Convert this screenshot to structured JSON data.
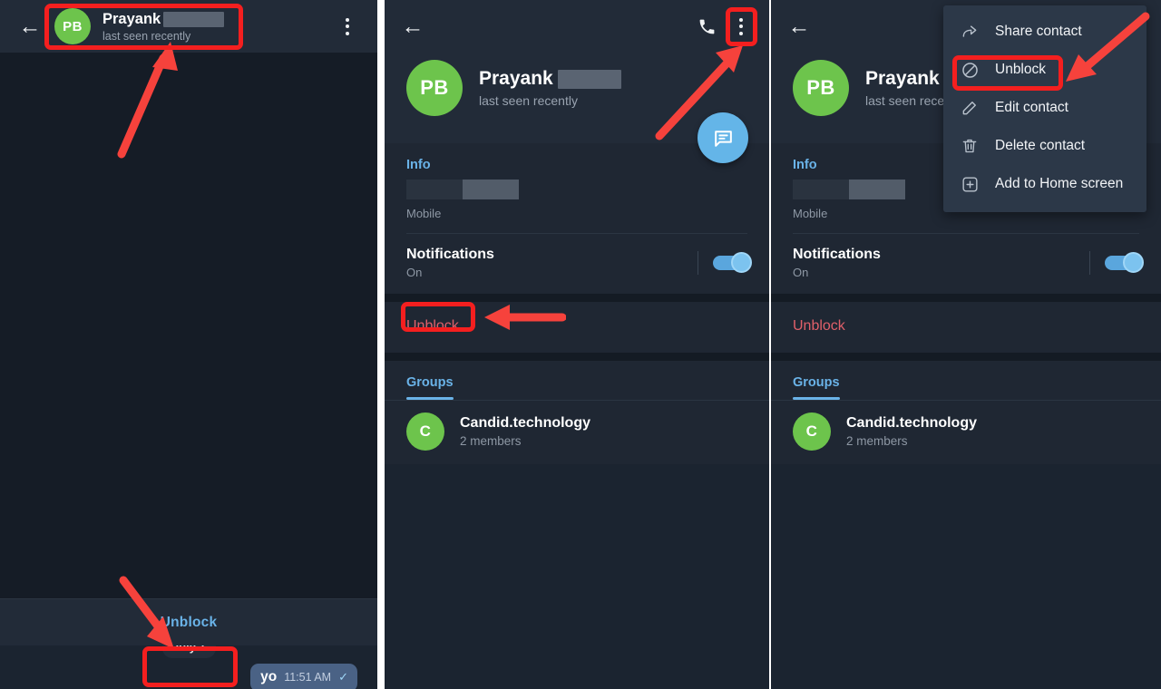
{
  "contact": {
    "initials": "PB",
    "name": "Prayank",
    "name_redacted": "",
    "status": "last seen recently",
    "status_truncated": "last seen recen"
  },
  "panel1": {
    "back_icon": "back-arrow-icon",
    "overflow_icon": "more-vertical-icon",
    "date_chip": "July 1",
    "message": {
      "text": "yo",
      "time": "11:51 AM",
      "receipt": "✓"
    },
    "unblock_label": "Unblock"
  },
  "panel2": {
    "back_icon": "back-arrow-icon",
    "call_icon": "phone-icon",
    "overflow_icon": "more-vertical-icon",
    "fab_icon": "message-icon",
    "info_title": "Info",
    "info_sublabel": "Mobile",
    "notifications": {
      "title": "Notifications",
      "state": "On",
      "toggle": "on"
    },
    "unblock_label": "Unblock",
    "groups_tab": "Groups",
    "group": {
      "initial": "C",
      "name": "Candid.technology",
      "members": "2 members"
    }
  },
  "panel3": {
    "back_icon": "back-arrow-icon",
    "info_title": "Info",
    "info_sublabel": "Mobile",
    "notifications": {
      "title": "Notifications",
      "state": "On",
      "toggle": "on"
    },
    "unblock_label": "Unblock",
    "groups_tab": "Groups",
    "group": {
      "initial": "C",
      "name": "Candid.technology",
      "members": "2 members"
    },
    "menu": {
      "items": [
        {
          "icon": "share-icon",
          "label": "Share contact"
        },
        {
          "icon": "block-icon",
          "label": "Unblock"
        },
        {
          "icon": "pencil-icon",
          "label": "Edit contact"
        },
        {
          "icon": "trash-icon",
          "label": "Delete contact"
        },
        {
          "icon": "add-box-icon",
          "label": "Add to Home screen"
        }
      ]
    }
  },
  "colors": {
    "accent_blue": "#6ab3e8",
    "avatar_green": "#6dc44c",
    "danger_red": "#e0606a",
    "annotation_red": "#f41f1f",
    "bubble_blue": "#4a6285",
    "fab_blue": "#64b5e8",
    "panel_bg": "#1f2733",
    "chat_bg": "#151c26",
    "appbar_bg": "#222b38",
    "menu_bg": "#2c3848"
  }
}
